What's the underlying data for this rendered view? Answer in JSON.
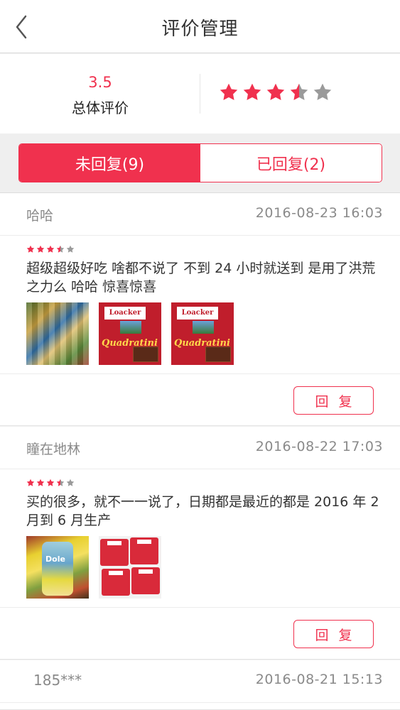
{
  "nav": {
    "title": "评价管理"
  },
  "summary": {
    "score": "3.5",
    "score_label": "总体评价",
    "rating": 3.5,
    "star_color": "#f0314e",
    "star_empty_color": "#9a9a9a"
  },
  "tabs": [
    {
      "label": "未回复(9)",
      "active": true
    },
    {
      "label": "已回复(2)",
      "active": false
    }
  ],
  "reviews": [
    {
      "user": "哈哈",
      "date": "2016-08-23 16:03",
      "rating": 3.5,
      "text": "超级超级好吃 啥都不说了 不到 24 小时就送到 是用了洪荒之力么 哈哈 惊喜惊喜",
      "images": [
        "snacks-photo",
        "loacker-quadratini-photo",
        "loacker-box-photo"
      ],
      "reply_label": "回复"
    },
    {
      "user": "瞳在地林",
      "date": "2016-08-22 17:03",
      "rating": 3.5,
      "text": "买的很多，就不一一说了，日期都是最近的都是 2016 年 2 月到 6 月生产",
      "images": [
        "dole-drinks-photo",
        "loacker-bags-photo"
      ],
      "reply_label": "回复"
    },
    {
      "user": "185***",
      "date": "2016-08-21 15:13"
    }
  ],
  "icons": {
    "back": "back-chevron-icon",
    "star": "star-icon"
  },
  "colors": {
    "accent": "#f0314e",
    "muted_text": "#8a8a8a"
  },
  "loacker_brand_text": "Loacker",
  "quadratini_text": "Quadratini"
}
